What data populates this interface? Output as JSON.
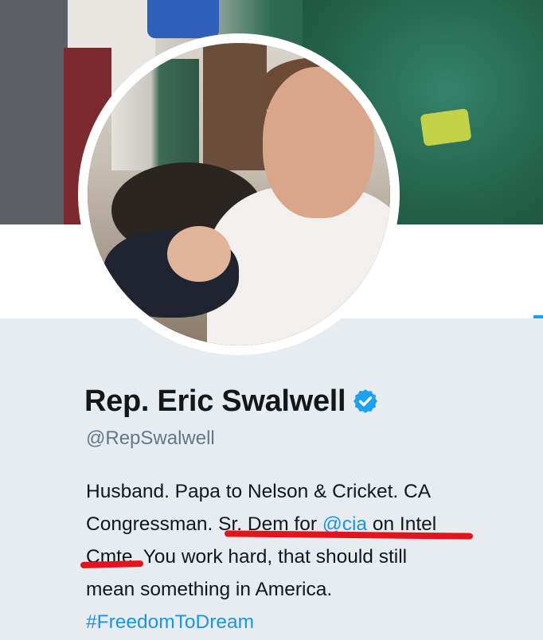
{
  "profile": {
    "name": "Rep. Eric Swalwell",
    "handle": "@RepSwalwell",
    "verified": true,
    "bio": {
      "line1": "Husband. Papa to Nelson & Cricket. CA",
      "line2_before": "Congressman. Sr. Dem for ",
      "line2_mention": "@cia",
      "line2_after": " on Intel",
      "line3": "Cmte. You work hard, that should still",
      "line4": "mean something in America.",
      "hashtag": "#FreedomToDream"
    }
  },
  "colors": {
    "link": "#1b95e0",
    "verified_badge": "#1da1f2",
    "annotation_underline": "#e3141b"
  }
}
